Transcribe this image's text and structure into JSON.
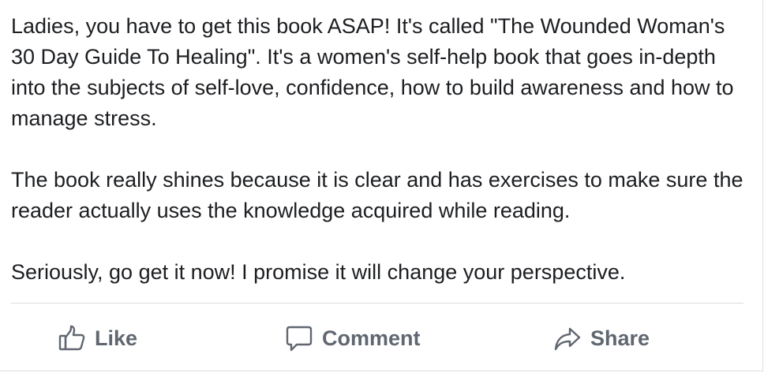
{
  "post": {
    "paragraphs": [
      "Ladies, you have to get this book ASAP! It's called \"The Wounded Woman's 30 Day Guide To Healing\". It's a women's self-help book that goes in-depth into the subjects of self-love, confidence, how to build awareness and how to manage stress.",
      "The book really shines because it is clear and has exercises to make sure the reader actually uses the knowledge acquired while reading.",
      "Seriously, go get it now! I promise it will change your perspective."
    ]
  },
  "actions": {
    "like": {
      "label": "Like",
      "icon": "thumbs-up-icon"
    },
    "comment": {
      "label": "Comment",
      "icon": "speech-bubble-icon"
    },
    "share": {
      "label": "Share",
      "icon": "share-arrow-icon"
    }
  },
  "colors": {
    "text": "#1c1e21",
    "action_text": "#606770",
    "divider": "#dadde1"
  }
}
